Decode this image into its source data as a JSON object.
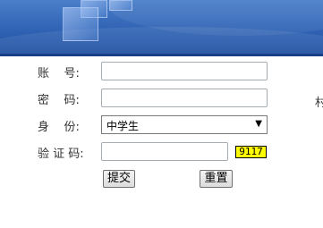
{
  "form": {
    "account_label": "账    号:",
    "password_label": "密    码:",
    "identity_label": "身    份:",
    "identity_value": "中学生",
    "captcha_label": "验 证 码:",
    "captcha_code": "9117",
    "submit_label": "提交",
    "reset_label": "重置"
  },
  "edge_text": "村",
  "colors": {
    "banner": "#2f62b3",
    "captcha_bg": "#ffff00"
  }
}
